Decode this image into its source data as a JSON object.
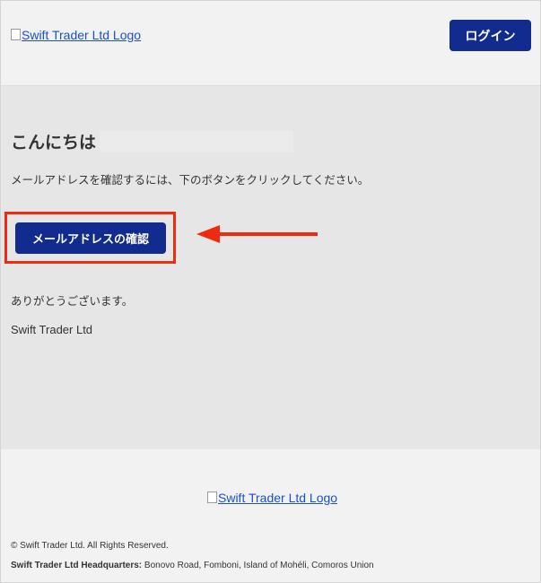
{
  "header": {
    "logo_alt": "Swift Trader Ltd Logo",
    "login_label": "ログイン"
  },
  "main": {
    "greeting": "こんにちは",
    "instruction": "メールアドレスを確認するには、下のボタンをクリックしてください。",
    "confirm_label": "メールアドレスの確認",
    "thanks": "ありがとうございます。",
    "sender": "Swift Trader Ltd"
  },
  "footer": {
    "logo_alt": "Swift Trader Ltd Logo",
    "copyright": "© Swift Trader Ltd. All Rights Reserved.",
    "hq_label": "Swift Trader Ltd Headquarters:",
    "hq_address": "Bonovo Road, Fomboni, Island of Mohéli, Comoros Union"
  },
  "colors": {
    "button_bg": "#112b8f",
    "highlight": "#ee2b10",
    "link": "#1a4fd1"
  },
  "icons": {
    "broken_image": "broken-image-icon",
    "arrow": "left-arrow-icon"
  }
}
